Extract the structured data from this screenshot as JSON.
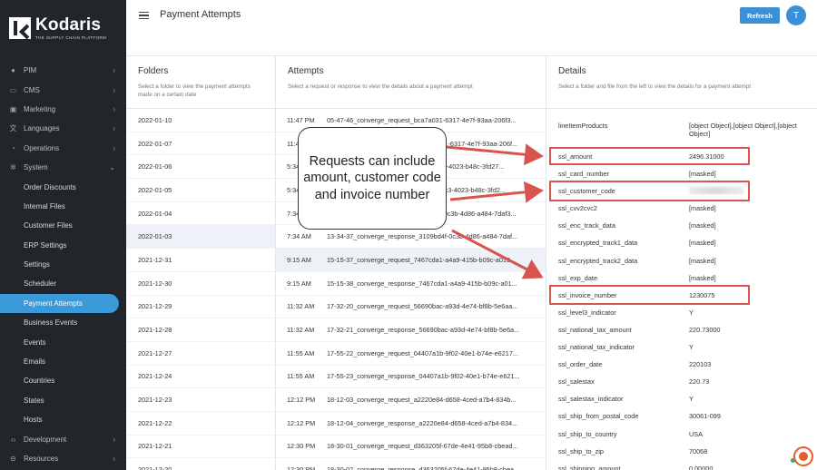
{
  "brand": {
    "name": "Kodaris",
    "tagline": "THE SUPPLY CHAIN PLATFORM"
  },
  "header": {
    "title": "Payment Attempts",
    "refresh_label": "Refresh",
    "avatar_initial": "T"
  },
  "sidebar": {
    "items": [
      {
        "label": "PIM",
        "icon": "tag-icon",
        "glyph": "●",
        "has_chevron": true,
        "sub": false
      },
      {
        "label": "CMS",
        "icon": "window-icon",
        "glyph": "▭",
        "has_chevron": true,
        "sub": false
      },
      {
        "label": "Marketing",
        "icon": "ad-icon",
        "glyph": "▣",
        "has_chevron": true,
        "sub": false
      },
      {
        "label": "Languages",
        "icon": "translate-icon",
        "glyph": "文",
        "has_chevron": true,
        "sub": false
      },
      {
        "label": "Operations",
        "icon": "chart-icon",
        "glyph": "◔",
        "has_chevron": true,
        "sub": false
      },
      {
        "label": "System",
        "icon": "gear-icon",
        "glyph": "✲",
        "has_chevron": true,
        "sub": false,
        "expanded": true
      },
      {
        "label": "Order Discounts",
        "sub": true
      },
      {
        "label": "Internal Files",
        "sub": true
      },
      {
        "label": "Customer Files",
        "sub": true
      },
      {
        "label": "ERP Settings",
        "sub": true
      },
      {
        "label": "Settings",
        "sub": true
      },
      {
        "label": "Scheduler",
        "sub": true
      },
      {
        "label": "Payment Attempts",
        "sub": true,
        "active": true
      },
      {
        "label": "Business Events",
        "sub": true
      },
      {
        "label": "Events",
        "sub": true
      },
      {
        "label": "Emails",
        "sub": true
      },
      {
        "label": "Countries",
        "sub": true
      },
      {
        "label": "States",
        "sub": true
      },
      {
        "label": "Hosts",
        "sub": true
      },
      {
        "label": "Development",
        "icon": "code-icon",
        "glyph": "‹›",
        "has_chevron": true,
        "sub": false
      },
      {
        "label": "Resources",
        "icon": "resources-icon",
        "glyph": "⊝",
        "has_chevron": true,
        "sub": false
      }
    ]
  },
  "folders": {
    "title": "Folders",
    "subtitle": "Select a folder to view the payment attempts made on a certain date",
    "rows": [
      "2022-01-10",
      "2022-01-07",
      "2022-01-06",
      "2022-01-05",
      "2022-01-04",
      "2022-01-03",
      "2021-12-31",
      "2021-12-30",
      "2021-12-29",
      "2021-12-28",
      "2021-12-27",
      "2021-12-24",
      "2021-12-23",
      "2021-12-22",
      "2021-12-21",
      "2021-12-20"
    ],
    "active_index": 5
  },
  "attempts": {
    "title": "Attempts",
    "subtitle": "Select a request or response to view the details about a payment attempt",
    "rows": [
      {
        "time": "11:47 PM",
        "name": "05-47-46_converge_request_bca7a031-6317-4e7f-93aa-206f3..."
      },
      {
        "time": "11:47 PM",
        "name": "05-47-46_converge_response_bca7a031-6317-4e7f-93aa-206f..."
      },
      {
        "time": "5:34 AM",
        "name": "11-34-07_converge_request_68ada-f1c3-4023-b48c-3fd27..."
      },
      {
        "time": "5:34 AM",
        "name": "11-34-07_converge_response_68ada-f1c3-4023-b48c-3fd2..."
      },
      {
        "time": "7:34 AM",
        "name": "13-34-37_converge_request_3109bd4f-0c3b-4d86-a484-7daf3..."
      },
      {
        "time": "7:34 AM",
        "name": "13-34-37_converge_response_3109bd4f-0c3b-4d86-a484-7daf..."
      },
      {
        "time": "9:15 AM",
        "name": "15-15-37_converge_request_7467cda1-a4a9-415b-b09c-a019..."
      },
      {
        "time": "9:15 AM",
        "name": "15-15-38_converge_response_7467cda1-a4a9-415b-b09c-a01..."
      },
      {
        "time": "11:32 AM",
        "name": "17-32-20_converge_request_56690bac-a93d-4e74-bf8b-5e6aa..."
      },
      {
        "time": "11:32 AM",
        "name": "17-32-21_converge_response_56690bac-a93d-4e74-bf8b-5e6a..."
      },
      {
        "time": "11:55 AM",
        "name": "17-55-22_converge_request_04407a1b-9f02-40e1-b74e-e6217..."
      },
      {
        "time": "11:55 AM",
        "name": "17-55-23_converge_response_04407a1b-9f02-40e1-b74e-e621..."
      },
      {
        "time": "12:12 PM",
        "name": "18-12-03_converge_request_a2220e84-d658-4ced-a7b4-834b..."
      },
      {
        "time": "12:12 PM",
        "name": "18-12-04_converge_response_a2220e84-d658-4ced-a7b4-834..."
      },
      {
        "time": "12:30 PM",
        "name": "18-30-01_converge_request_d363205f-67de-4e41-95b8-cbead..."
      },
      {
        "time": "12:30 PM",
        "name": "18-30-02_converge_response_d363205f-67de-4e41-95b8-cbea..."
      }
    ],
    "active_index": 6
  },
  "details": {
    "title": "Details",
    "subtitle": "Select a folder and file from the left to view the details for a payment attempt",
    "rows": [
      {
        "key": "lineItemProducts",
        "value": "[object Object],[object Object],[object Object]",
        "tall": true
      },
      {
        "key": "ssl_amount",
        "value": "2496.31000",
        "highlight": true
      },
      {
        "key": "ssl_card_number",
        "value": "[masked]"
      },
      {
        "key": "ssl_customer_code",
        "value": "",
        "blurred": true,
        "highlight": true
      },
      {
        "key": "ssl_cvv2cvc2",
        "value": "[masked]"
      },
      {
        "key": "ssl_enc_track_data",
        "value": "[masked]"
      },
      {
        "key": "ssl_encrypted_track1_data",
        "value": "[masked]"
      },
      {
        "key": "ssl_encrypted_track2_data",
        "value": "[masked]"
      },
      {
        "key": "ssl_exp_date",
        "value": "[masked]"
      },
      {
        "key": "ssl_invoice_number",
        "value": "1230075",
        "highlight": true
      },
      {
        "key": "ssl_level3_indicator",
        "value": "Y"
      },
      {
        "key": "ssl_national_tax_amount",
        "value": "220.73000"
      },
      {
        "key": "ssl_national_tax_indicator",
        "value": "Y"
      },
      {
        "key": "ssl_order_date",
        "value": "220103"
      },
      {
        "key": "ssl_salestax",
        "value": "220.73"
      },
      {
        "key": "ssl_salestax_indicator",
        "value": "Y"
      },
      {
        "key": "ssl_ship_from_postal_code",
        "value": "30061-099"
      },
      {
        "key": "ssl_ship_to_country",
        "value": "USA"
      },
      {
        "key": "ssl_ship_to_zip",
        "value": "70068"
      },
      {
        "key": "ssl_shipping_amount",
        "value": "0.00000"
      }
    ]
  },
  "annotation": {
    "text": "Requests can include amount, customer code and invoice number",
    "color": "#d9534f"
  },
  "colors": {
    "sidebar_bg": "#22262b",
    "accent": "#3a8fd6",
    "active_row": "#eef1f8",
    "help": "#e4602a"
  }
}
